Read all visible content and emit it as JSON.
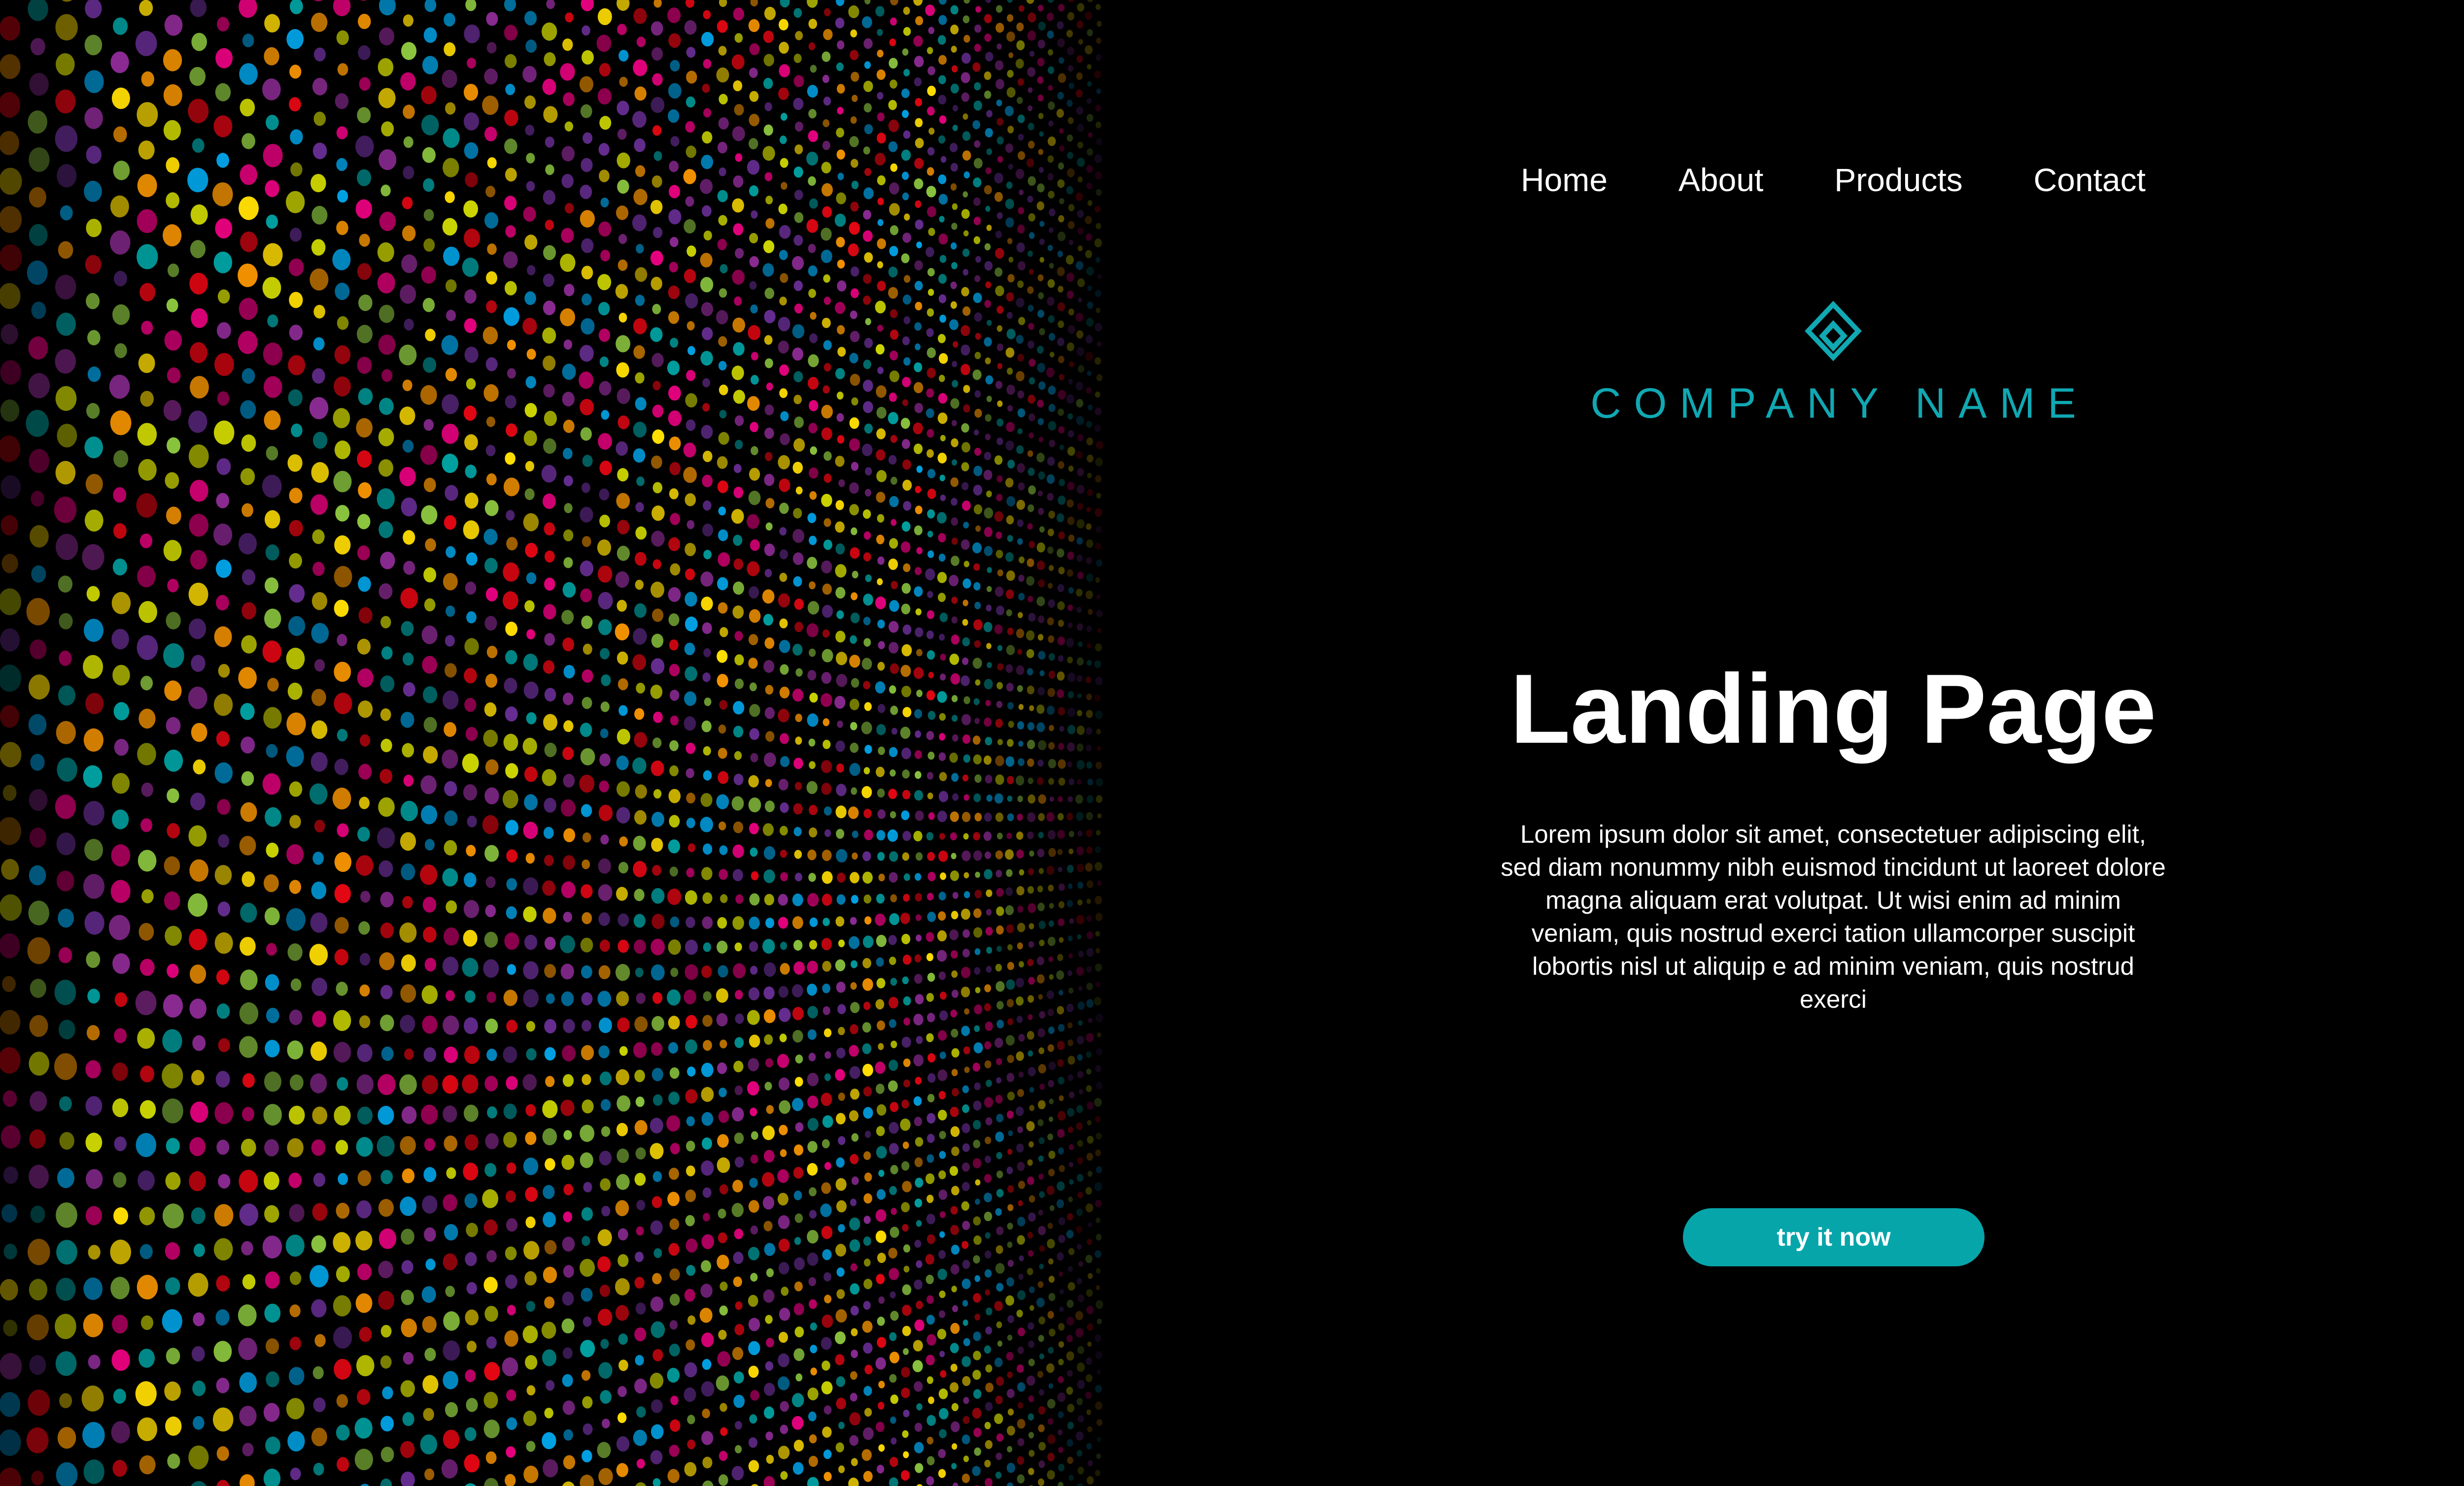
{
  "nav": {
    "items": [
      {
        "label": "Home"
      },
      {
        "label": "About"
      },
      {
        "label": "Products"
      },
      {
        "label": "Contact"
      }
    ]
  },
  "brand": {
    "icon": "diamond-logo-icon",
    "name": "COMPANY NAME",
    "color": "#10a8b3"
  },
  "hero": {
    "title": "Landing Page",
    "body": "Lorem ipsum dolor sit amet, consectetuer adipiscing elit, sed diam nonummy nibh euismod tincidunt ut laoreet dolore magna aliquam erat volutpat. Ut wisi enim ad minim veniam, quis nostrud exerci tation ullamcorper suscipit lobortis nisl ut aliquip e ad minim veniam, quis nostrud exerci"
  },
  "cta": {
    "label": "try it now",
    "color": "#06a5aa"
  },
  "background": {
    "page_color": "#000000",
    "dot_palette": [
      "#e6007e",
      "#ffdd00",
      "#00a0e3",
      "#e30613",
      "#8bc53f",
      "#662d91",
      "#f39200",
      "#009fa0",
      "#cbd400",
      "#8a2a92"
    ]
  }
}
